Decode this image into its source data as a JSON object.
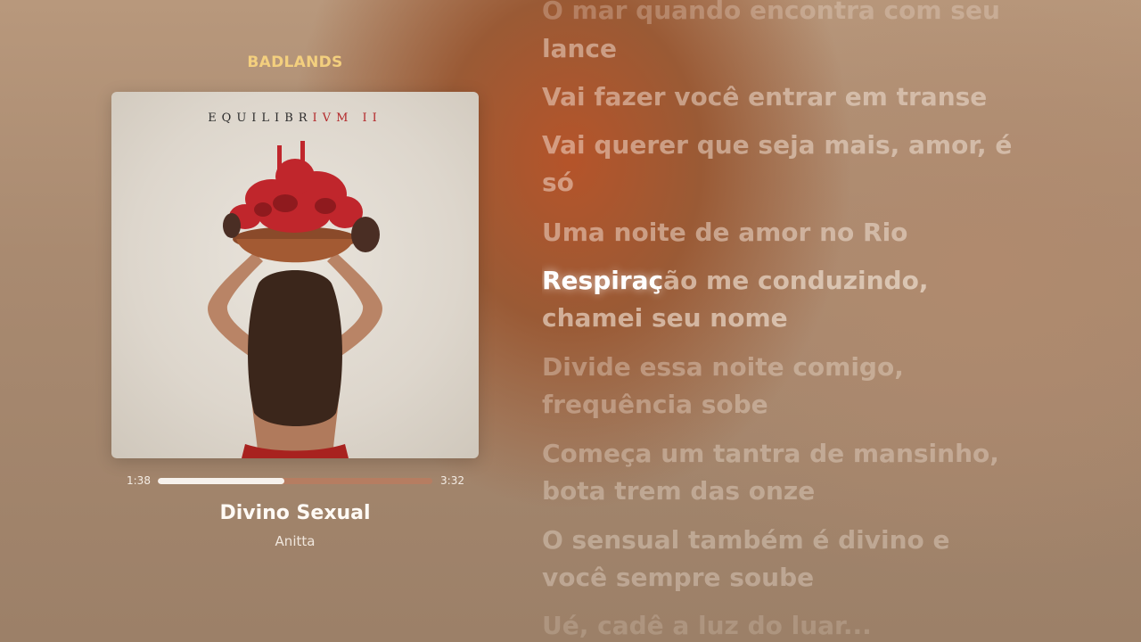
{
  "player": {
    "playlist_title": "BADLANDS",
    "album_art": {
      "title_prefix": "EQUILIBR",
      "title_red": "IVM",
      "title_suffix": " II"
    },
    "elapsed": "1:38",
    "duration": "3:32",
    "progress": 0.46,
    "song_title": "Divino Sexual",
    "artist": "Anitta",
    "colors": {
      "accent": "#f3cf7e",
      "progress_fill": "#f6f1ec"
    }
  },
  "lyrics": {
    "faded_top": "O mar quando encontra com seu",
    "line1_end": "lance",
    "line2": "Vai fazer você entrar em transe",
    "line3a": "Vai querer que seja mais, amor, é",
    "line3b": "só",
    "line4": "Uma noite de amor no Rio",
    "active_sung": "Respiraç",
    "active_rest": "ão me conduzindo,",
    "active_b": "chamei seu nome",
    "line6a": "Divide essa noite comigo,",
    "line6b": "frequência sobe",
    "line7a": "Começa um tantra de mansinho,",
    "line7b": "bota trem das onze",
    "line8a": "O sensual também é divino e",
    "line8b": "você sempre soube",
    "faded_bottom": "Ué, cadê a luz do luar..."
  }
}
